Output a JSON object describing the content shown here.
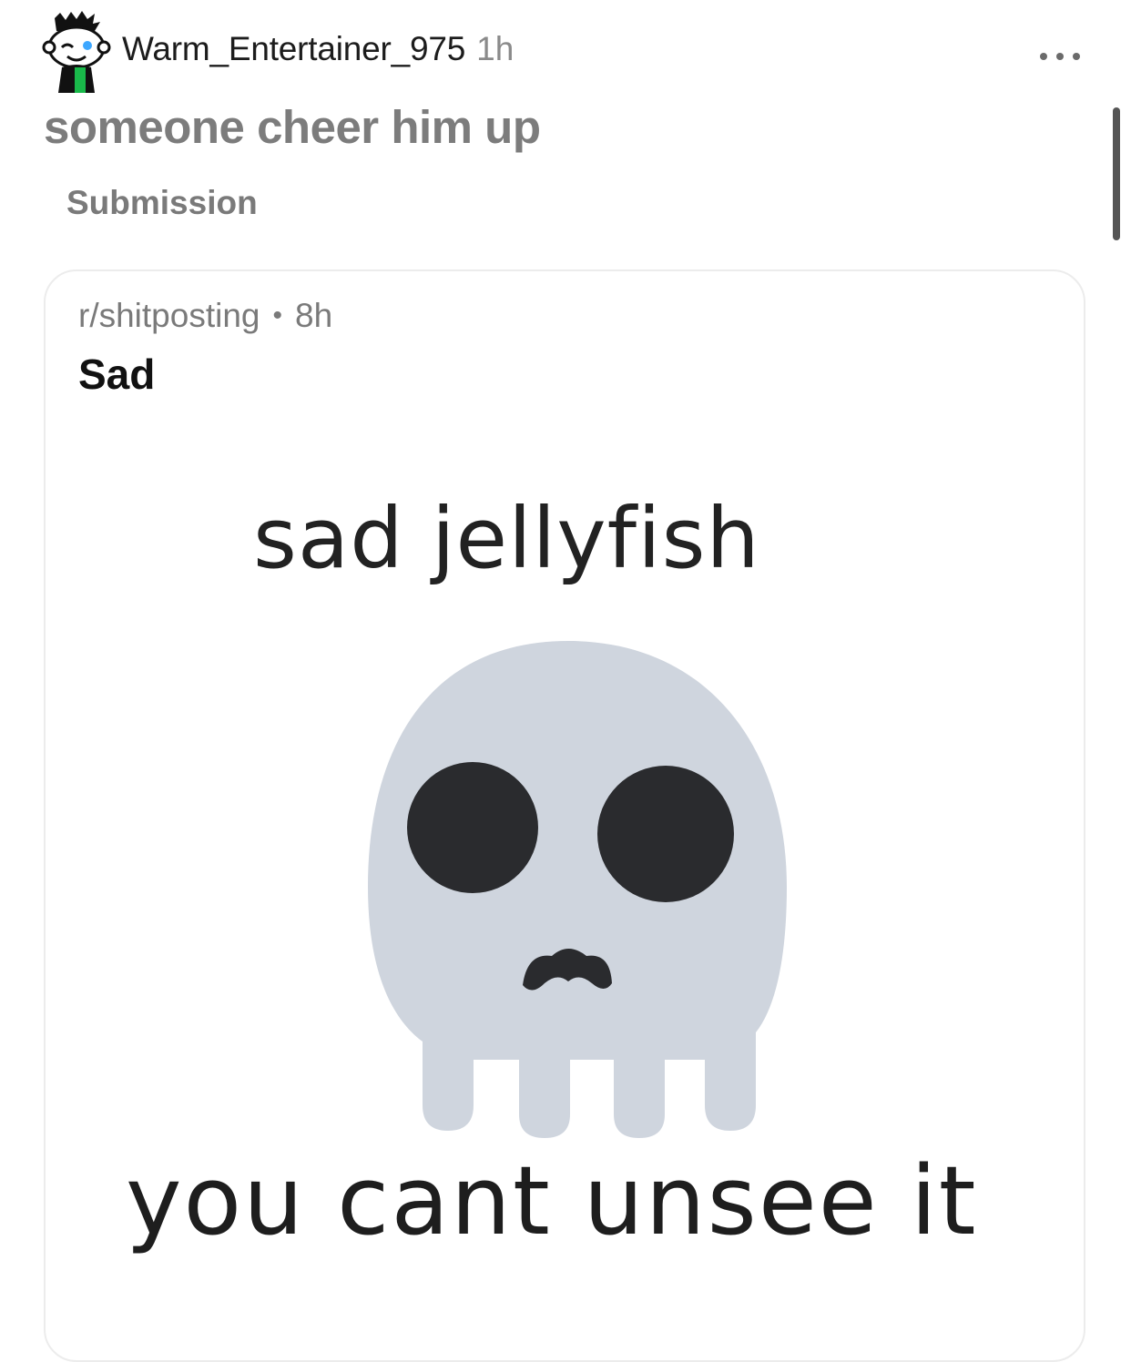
{
  "comment": {
    "author": "Warm_Entertainer_975",
    "time": "1h",
    "text": "someone cheer him up",
    "submission_label": "Submission",
    "avatar_icon": "snoo-avatar-icon",
    "more_icon": "more-horizontal-icon"
  },
  "embed": {
    "subreddit": "r/shitposting",
    "separator": "•",
    "time": "8h",
    "title": "Sad",
    "image": {
      "top_caption": "sad jellyfish",
      "bottom_caption": "you cant unsee it",
      "icon": "skull-icon",
      "skull_color": "#cfd5de",
      "feature_color": "#2a2b2e"
    }
  },
  "colors": {
    "username": "#1c1c1c",
    "muted": "#7a7a7a",
    "card_border": "#ececec"
  }
}
